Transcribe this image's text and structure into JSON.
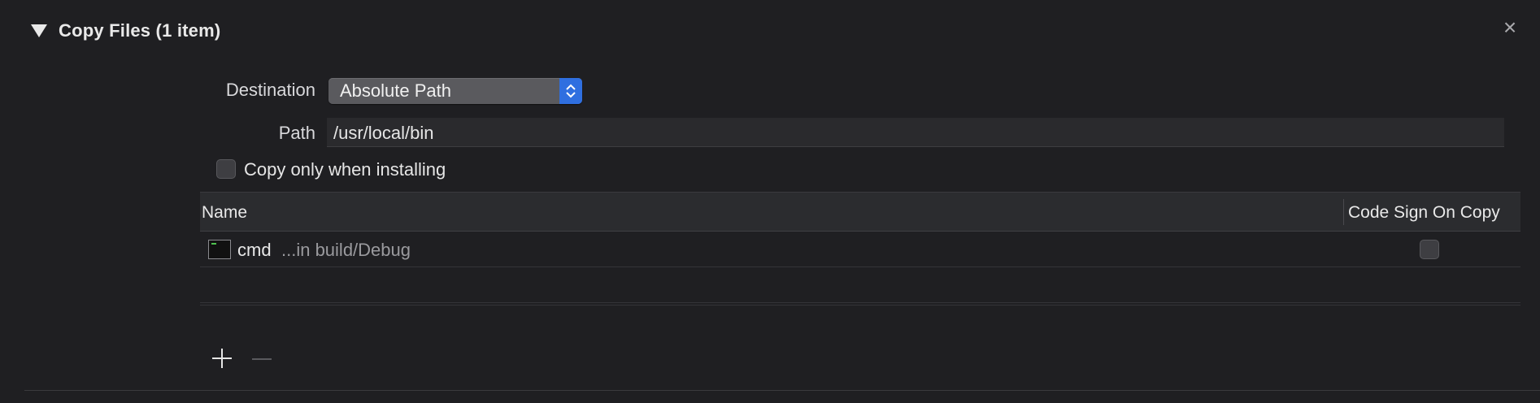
{
  "section": {
    "title": "Copy Files (1 item)",
    "close_icon": "×"
  },
  "form": {
    "destination_label": "Destination",
    "destination_value": "Absolute Path",
    "path_label": "Path",
    "path_value": "/usr/local/bin",
    "copy_only_label": "Copy only when installing",
    "copy_only_checked": false
  },
  "table": {
    "columns": [
      "Name",
      "Code Sign On Copy"
    ],
    "rows": [
      {
        "name": "cmd",
        "location": "...in build/Debug",
        "code_sign": false
      }
    ]
  },
  "icons": {
    "disclosure": "disclosure-triangle-down-icon",
    "close": "close-icon",
    "stepper": "up-down-chevron-icon",
    "file": "terminal-executable-icon",
    "add": "plus-icon",
    "remove": "minus-icon"
  },
  "colors": {
    "accent": "#2f6fe0",
    "background": "#1f1f22"
  }
}
